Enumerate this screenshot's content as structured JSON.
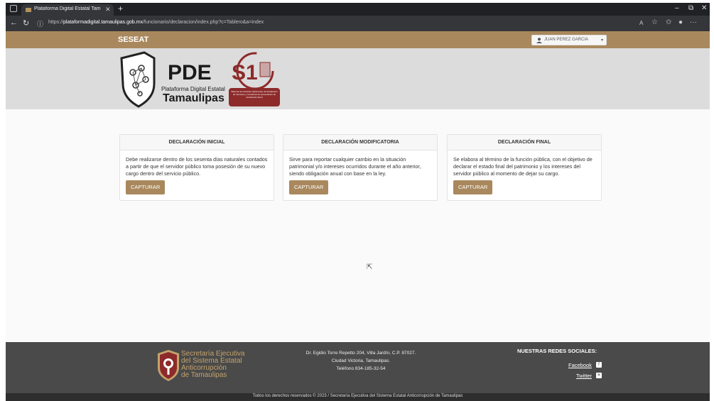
{
  "browser": {
    "tab_title": "Plataforma Digital Estatal Tamaulipas",
    "url_prefix": "https://",
    "url_domain": "plataformadigital.tamaulipas.gob.mx",
    "url_path": "/funcionario/declaracion/index.php?c=Tablero&a=index"
  },
  "site": {
    "brand": "SESEAT",
    "user_name": "JUAN PEREZ GARCIA",
    "logo_title": "PDE",
    "logo_subtitle": "Plataforma Digital Estatal",
    "logo_state": "Tamaulipas",
    "s1_label": "S1",
    "s1_caption": "Sistema de evolución patrimonial, de declaración de intereses y constancia de presentación de declaración fiscal"
  },
  "cards": [
    {
      "title": "DECLARACIÓN INICIAL",
      "text": "Debe realizarse dentro de los sesenta días naturales contados a partir de que el servidor público toma posesión de su nuevo cargo dentro del servicio público.",
      "button": "CAPTURAR"
    },
    {
      "title": "DECLARACIÓN MODIFICATORIA",
      "text": "Sirve para reportar cualquier cambio en la situación patrimonial y/o intereses ocurridos durante el año anterior, siendo obligación anual con base en la ley.",
      "button": "CAPTURAR"
    },
    {
      "title": "DECLARACIÓN FINAL",
      "text": "Se elabora al término de la función pública, con el objetivo de declarar el estado final del patrimonio y los intereses del servidor público al momento de dejar su cargo.",
      "button": "CAPTURAR"
    }
  ],
  "footer": {
    "org_line1": "Secretaría Ejecutiva",
    "org_line2": "del Sistema Estatal",
    "org_line3": "Anticorrupción",
    "org_line4": "de Tamaulipas",
    "address_line1": "Dr. Egidio Torre Repetto 204, Villa Jardín, C.P. 87027.",
    "address_line2": "Ciudad Victoria, Tamaulipas.",
    "address_line3": "Teléfono 834-185-32-54",
    "social_title": "NUESTRAS REDES SOCIALES:",
    "facebook": "Facebook",
    "twitter": "Twitter",
    "copyright": "Todos los derechos reservados © 2023 / Secretaría Ejecutiva del Sistema Estatal Anticorrupción de Tamaulipas"
  },
  "colors": {
    "accent": "#a9885d",
    "header_bg": "#dcdcdc",
    "footer_bg": "#4a4a4a",
    "s1_red": "#8d2a2a"
  }
}
